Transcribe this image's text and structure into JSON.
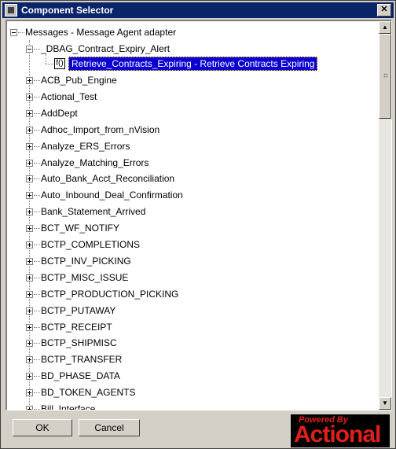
{
  "window": {
    "title": "Component Selector"
  },
  "tree": {
    "root": "Messages - Message Agent adapter",
    "expanded_group": "_DBAG_Contract_Expiry_Alert",
    "selected_leaf": {
      "icon": "f()",
      "label": "Retrieve_Contracts_Expiring - Retrieve Contracts Expiring"
    },
    "items": [
      "ACB_Pub_Engine",
      "Actional_Test",
      "AddDept",
      "Adhoc_Import_from_nVision",
      "Analyze_ERS_Errors",
      "Analyze_Matching_Errors",
      "Auto_Bank_Acct_Reconciliation",
      "Auto_Inbound_Deal_Confirmation",
      "Bank_Statement_Arrived",
      "BCT_WF_NOTIFY",
      "BCTP_COMPLETIONS",
      "BCTP_INV_PICKING",
      "BCTP_MISC_ISSUE",
      "BCTP_PRODUCTION_PICKING",
      "BCTP_PUTAWAY",
      "BCTP_RECEIPT",
      "BCTP_SHIPMISC",
      "BCTP_TRANSFER",
      "BD_PHASE_DATA",
      "BD_TOKEN_AGENTS",
      "Bill_Interface"
    ]
  },
  "scrollbar": {
    "up": "▲",
    "down": "▼"
  },
  "buttons": {
    "ok": "OK",
    "cancel": "Cancel"
  },
  "logo": {
    "tagline": "Powered By",
    "brand": "Actional"
  },
  "colors": {
    "title_bar": "#0a246a",
    "selection": "#0a00d0",
    "logo_red": "#e0201a"
  }
}
